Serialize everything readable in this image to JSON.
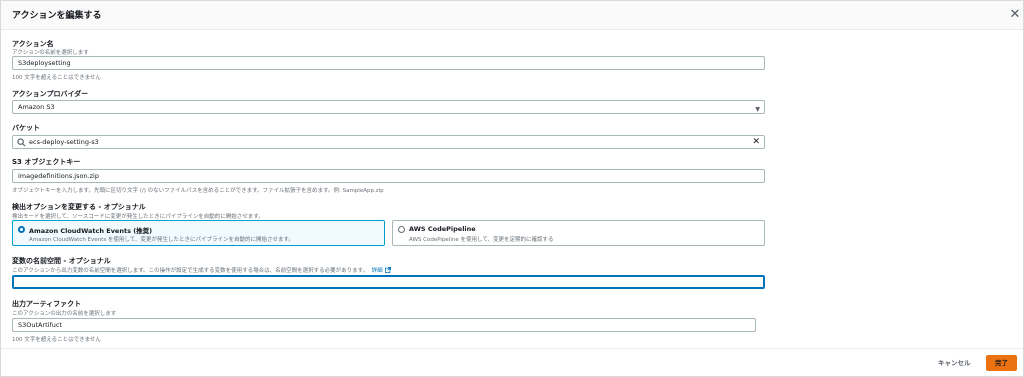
{
  "dialog": {
    "title": "アクションを編集する",
    "close_icon": "close-icon"
  },
  "action_name": {
    "label": "アクション名",
    "description": "アクションの名前を選択します",
    "value": "S3deploysetting",
    "constraint": "100 文字を超えることはできません"
  },
  "action_provider": {
    "label": "アクションプロバイダー",
    "value": "Amazon S3"
  },
  "bucket": {
    "label": "バケット",
    "value": "ecs-deploy-setting-s3"
  },
  "s3_object_key": {
    "label": "S3 オブジェクトキー",
    "value": "imagedefinitions.json.zip",
    "hint": "オブジェクトキーを入力します。先頭に区切り文字 (/) のないファイルパスを含めることができます。ファイル拡張子を含めます。例: SampleApp.zip"
  },
  "detection": {
    "label": "検出オプションを変更する - オプショナル",
    "description": "検出モードを選択して、ソースコードに変更が発生したときにパイプラインを自動的に開始させます。",
    "options": [
      {
        "title": "Amazon CloudWatch Events (推奨)",
        "description": "Amazon CloudWatch Events を使用して、変更が発生したときにパイプラインを自動的に開始させます。",
        "selected": true
      },
      {
        "title": "AWS CodePipeline",
        "description": "AWS CodePipeline を使用して、変更を定期的に確認する",
        "selected": false
      }
    ]
  },
  "variable_namespace": {
    "label": "変数の名前空間 - オプショナル",
    "description": "このアクションから出力変数の名前空間を選択します。この操作が設定で生成する変数を使用する場合は、名前空間を選択する必要があります。",
    "link": "詳細",
    "value": ""
  },
  "output_artifact": {
    "label": "出力アーティファクト",
    "description": "このアクションの出力の名前を選択します",
    "value": "S3OutArtifuct",
    "constraint": "100 文字を超えることはできません"
  },
  "footer": {
    "cancel_label": "キャンセル",
    "done_label": "完了",
    "done_color": "#ec7211"
  }
}
